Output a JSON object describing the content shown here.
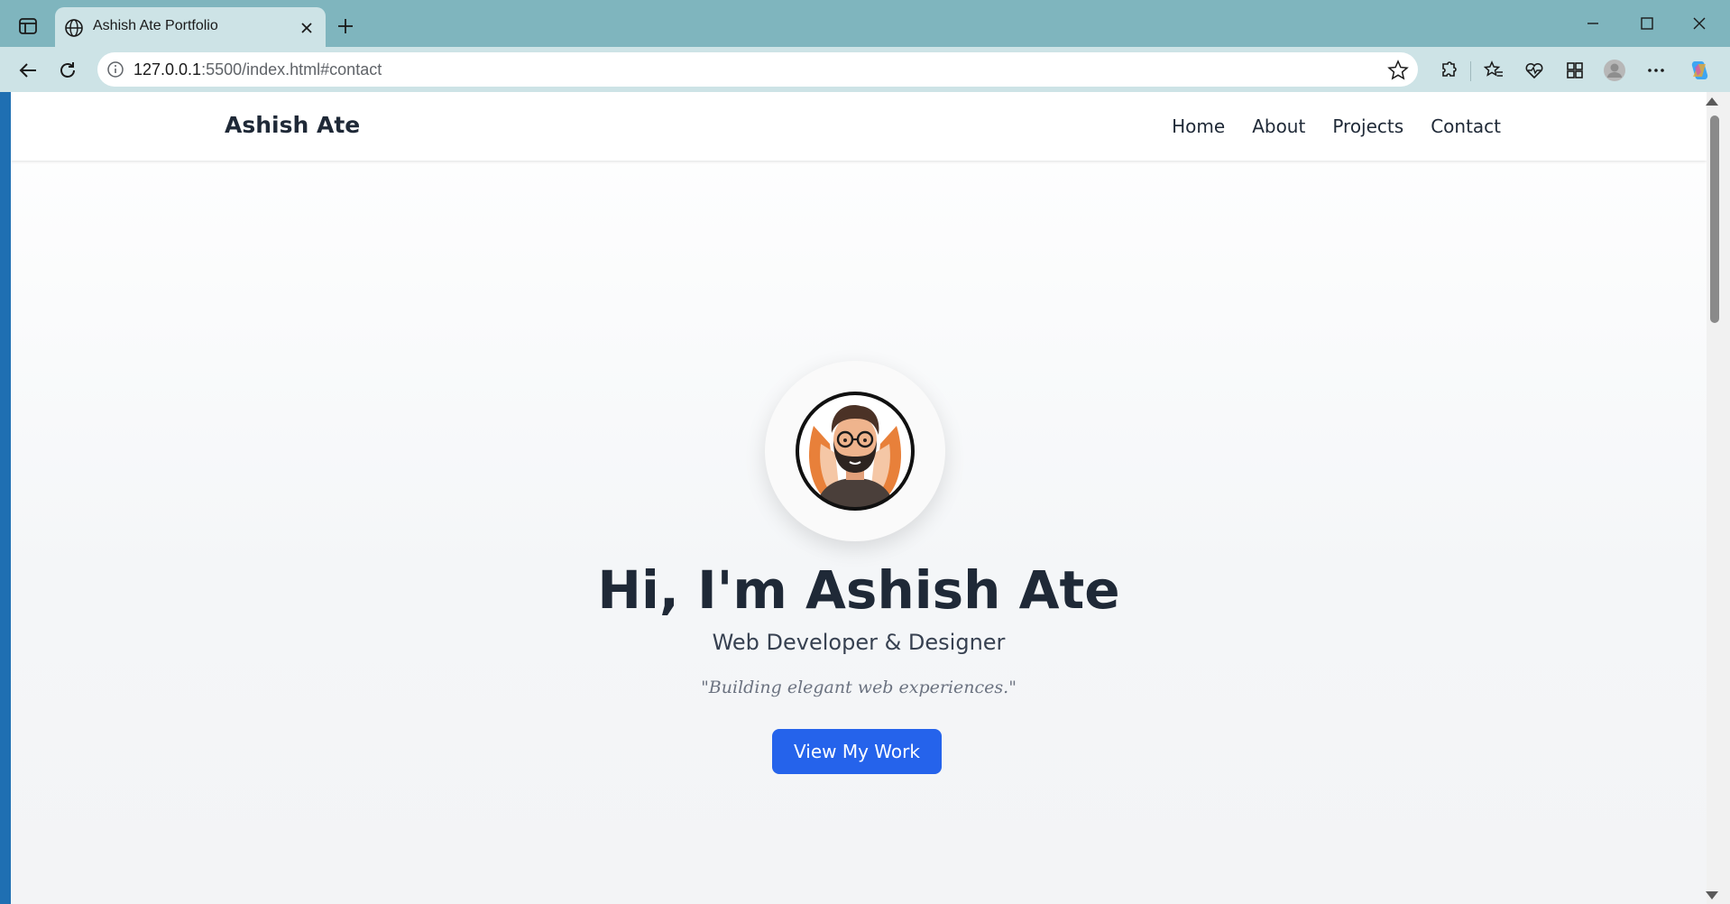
{
  "browser": {
    "tab_title": "Ashish Ate Portfolio",
    "url_host": "127.0.0.1",
    "url_rest": ":5500/index.html#contact",
    "accent": "#7fb5be"
  },
  "site": {
    "brand": "Ashish Ate",
    "nav": [
      "Home",
      "About",
      "Projects",
      "Contact"
    ],
    "hero": {
      "title": "Hi, I'm Ashish Ate",
      "subtitle": "Web Developer & Designer",
      "quote": "\"Building elegant web experiences.\"",
      "cta_label": "View My Work",
      "cta_color": "#2563eb"
    }
  }
}
